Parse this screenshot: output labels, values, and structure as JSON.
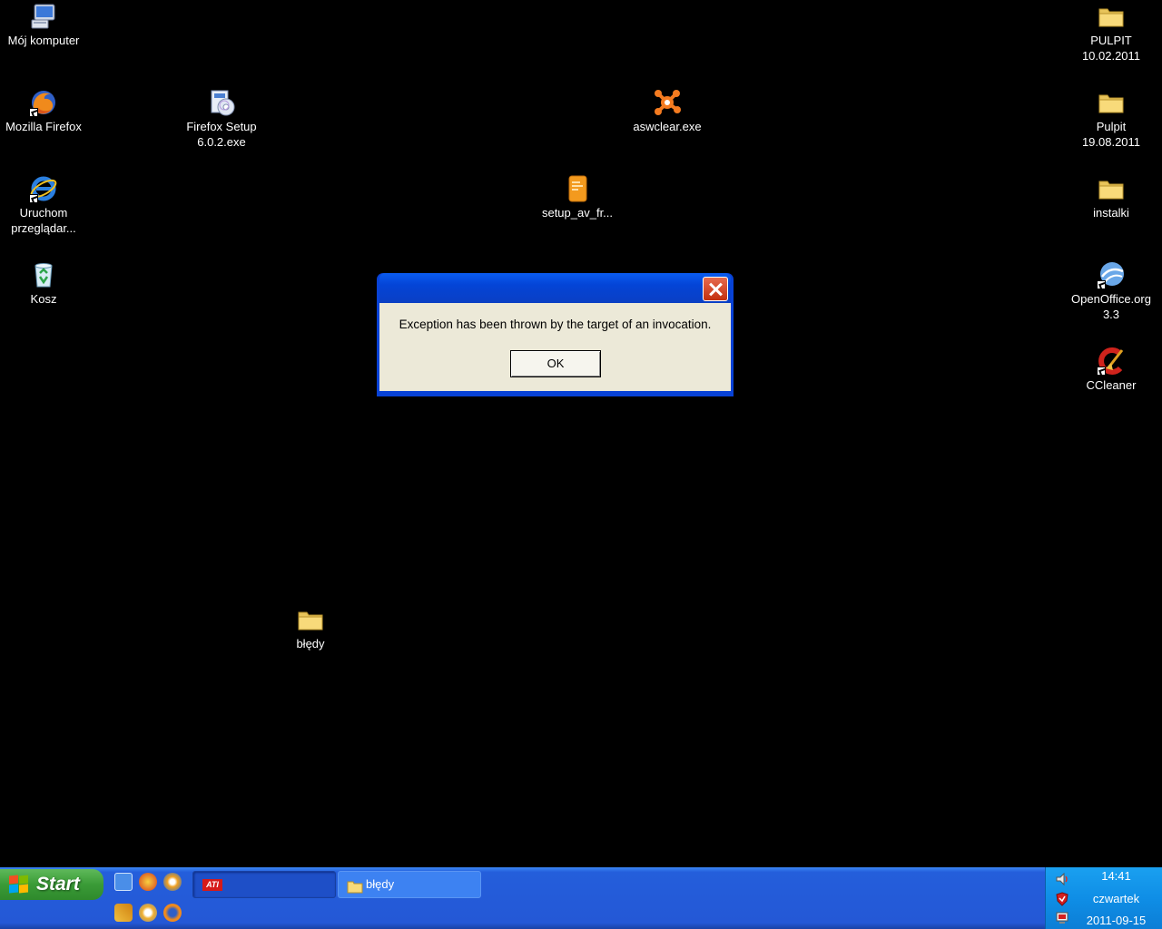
{
  "desktop": {
    "icons": {
      "my_computer": "Mój komputer",
      "firefox": "Mozilla Firefox",
      "firefox_setup": "Firefox Setup\n6.0.2.exe",
      "aswclear": "aswclear.exe",
      "ie": "Uruchom\nprzeglądar...",
      "setup_av": "setup_av_fr...",
      "recycle_bin": "Kosz",
      "pulpit1": "PULPIT\n10.02.2011",
      "pulpit2": "Pulpit\n19.08.2011",
      "instalki": "instalki",
      "openoffice": "OpenOffice.org\n3.3",
      "ccleaner": "CCleaner",
      "bledy": "błędy"
    }
  },
  "dialog": {
    "title": "",
    "message": "Exception has been thrown by the target of an invocation.",
    "ok_label": "OK"
  },
  "taskbar": {
    "start_label": "Start",
    "tasks": {
      "ati_logo": "ATI",
      "ati_label": "",
      "bledy_label": "błędy"
    },
    "tray": {
      "time": "14:41",
      "day": "czwartek",
      "date": "2011-09-15"
    }
  },
  "colors": {
    "desktop_bg": "#000000",
    "taskbar_blue": "#245edb",
    "start_green": "#3a9b37",
    "dialog_face": "#ece9d8",
    "tray_blue": "#0f8ee6"
  }
}
